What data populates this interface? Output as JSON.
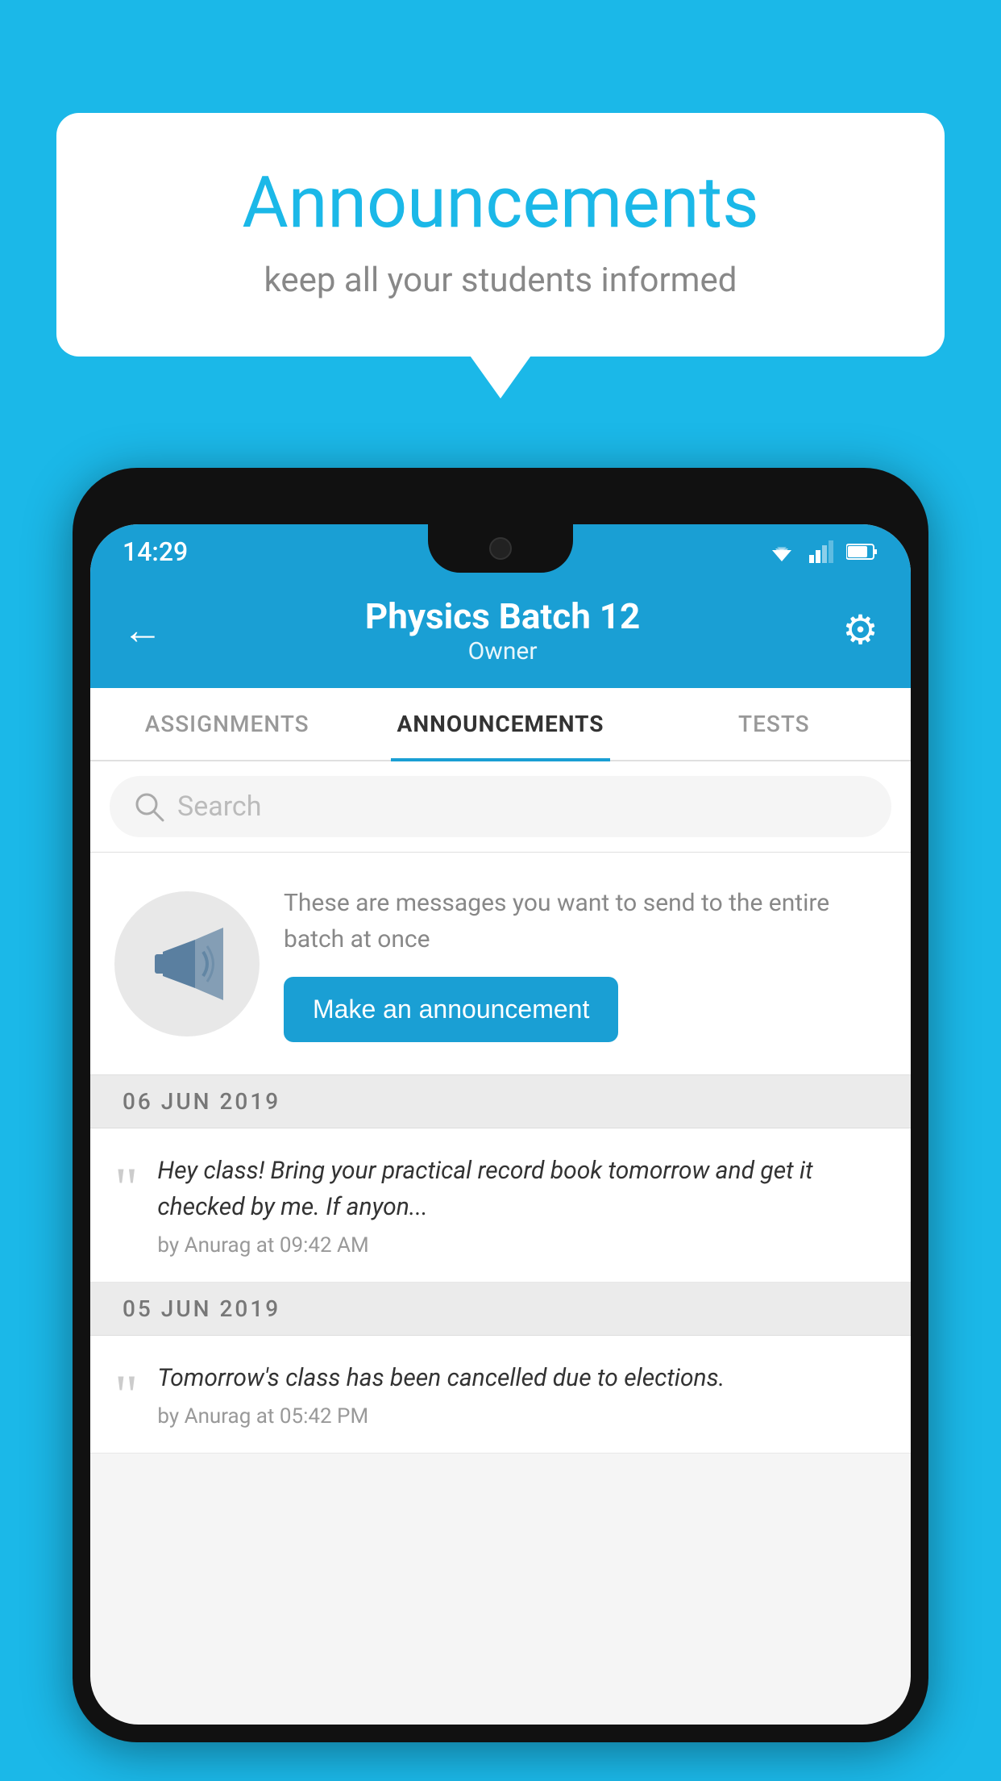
{
  "page": {
    "background_color": "#1BB8E8"
  },
  "speech_bubble": {
    "title": "Announcements",
    "subtitle": "keep all your students informed"
  },
  "phone": {
    "status_bar": {
      "time": "14:29"
    },
    "header": {
      "back_label": "←",
      "title": "Physics Batch 12",
      "subtitle": "Owner",
      "gear_label": "⚙"
    },
    "tabs": [
      {
        "label": "ASSIGNMENTS",
        "active": false
      },
      {
        "label": "ANNOUNCEMENTS",
        "active": true
      },
      {
        "label": "TESTS",
        "active": false
      }
    ],
    "search": {
      "placeholder": "Search"
    },
    "promo": {
      "description": "These are messages you want to send to the entire batch at once",
      "button_label": "Make an announcement"
    },
    "announcements": [
      {
        "date": "06  JUN  2019",
        "text": "Hey class! Bring your practical record book tomorrow and get it checked by me. If anyon...",
        "meta": "by Anurag at 09:42 AM"
      },
      {
        "date": "05  JUN  2019",
        "text": "Tomorrow's class has been cancelled due to elections.",
        "meta": "by Anurag at 05:42 PM"
      }
    ]
  }
}
